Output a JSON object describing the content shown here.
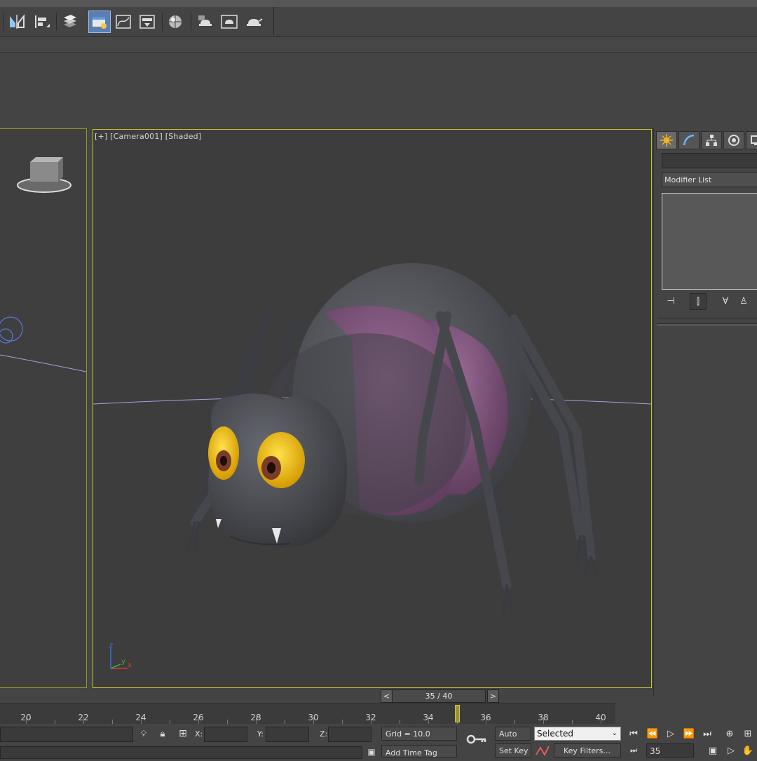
{
  "toolbar": {
    "icons": [
      "mirror-icon",
      "align-icon",
      "layers-icon",
      "scene-explorer-icon",
      "curve-editor-icon",
      "schematic-view-icon",
      "material-editor-icon",
      "render-setup-icon",
      "render-frame-icon",
      "render-icon"
    ],
    "active_icon": "scene-explorer-icon"
  },
  "viewport": {
    "label": "[+] [Camera001] [Shaded]",
    "axis_labels": {
      "x": "x",
      "y": "y",
      "z": "z"
    }
  },
  "command_panel": {
    "tabs": [
      "create-icon",
      "modify-icon",
      "hierarchy-icon",
      "motion-icon",
      "display-icon"
    ],
    "active_tab": "create-icon",
    "modifier_list": "Modifier List",
    "stack_icons": [
      "pin-stack-icon",
      "show-end-result-icon",
      "make-unique-icon",
      "remove-modifier-icon",
      "configure-sets-icon"
    ]
  },
  "time_slider": {
    "label": "35 / 40",
    "prev": "<",
    "next": ">",
    "current_frame": 35,
    "total_frames": 40
  },
  "trackbar": {
    "labels": [
      "20",
      "22",
      "24",
      "26",
      "28",
      "30",
      "32",
      "34",
      "36",
      "38",
      "40"
    ]
  },
  "status": {
    "x_label": "X:",
    "y_label": "Y:",
    "z_label": "Z:",
    "grid": "Grid = 10.0",
    "add_time_tag": "Add Time Tag",
    "auto_key": "Auto Key",
    "set_key": "Set Key",
    "selected": "Selected",
    "key_filters": "Key Filters...",
    "frame": "35"
  },
  "colors": {
    "viewport_border": "#c7c02e",
    "spider_body": "#4b4d52",
    "spider_stripe": "#7a4f78",
    "eye": "#f2c400"
  }
}
